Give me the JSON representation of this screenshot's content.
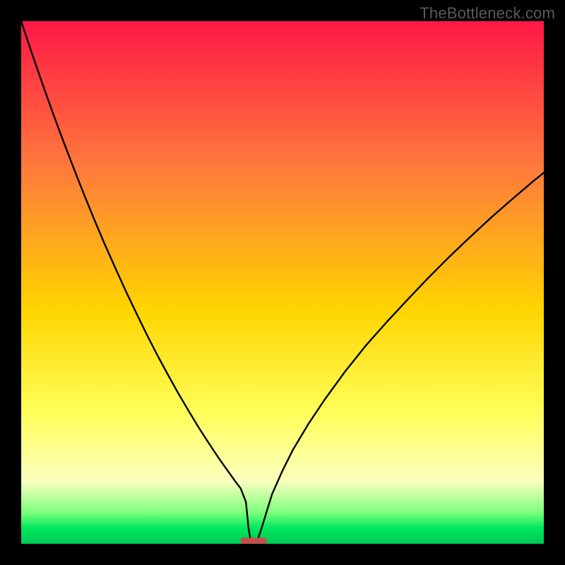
{
  "watermark": "TheBottleneck.com",
  "gradient": {
    "top": "#ff1846",
    "mid1": "#ff7a3c",
    "mid2": "#ffd400",
    "mid3": "#ffff5a",
    "pale": "#faffbe",
    "green1": "#7dff7d",
    "green2": "#00e85e",
    "bottom": "#00c853"
  },
  "chart_data": {
    "type": "line",
    "title": "",
    "xlabel": "",
    "ylabel": "",
    "xlim": [
      0,
      100
    ],
    "ylim": [
      0,
      100
    ],
    "x": [
      0,
      2,
      4,
      6,
      8,
      10,
      12,
      14,
      16,
      18,
      20,
      22,
      24,
      26,
      28,
      30,
      32,
      34,
      36,
      38,
      40,
      41,
      42,
      43,
      43.5,
      44,
      45,
      46,
      48,
      50,
      52,
      55,
      58,
      62,
      66,
      70,
      74,
      78,
      82,
      86,
      90,
      94,
      98,
      100
    ],
    "values": [
      100,
      94,
      88.2,
      82.6,
      77.2,
      72,
      66.9,
      62,
      57.3,
      52.8,
      48.4,
      44.2,
      40.1,
      36.2,
      32.5,
      28.9,
      25.5,
      22.2,
      19.1,
      16.1,
      13.3,
      11.9,
      10.6,
      8.0,
      3.0,
      0,
      0,
      3.0,
      9.5,
      14.0,
      18.0,
      23.0,
      27.5,
      33.0,
      38.0,
      42.5,
      46.8,
      51.0,
      55.0,
      58.8,
      62.5,
      66.0,
      69.4,
      71.0
    ],
    "minimum_marker": {
      "x_center": 44.5,
      "x_halfwidth": 2.5,
      "y": 0.5,
      "color": "#c0504d"
    }
  }
}
